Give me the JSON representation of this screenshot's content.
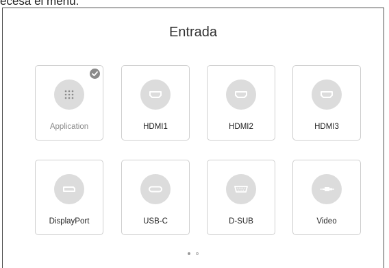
{
  "caption": "ecesa el menú.",
  "panel": {
    "title": "Entrada"
  },
  "inputs": [
    {
      "label": "Application",
      "icon": "apps-grid-icon",
      "selected": true
    },
    {
      "label": "HDMI1",
      "icon": "hdmi-port-icon",
      "selected": false
    },
    {
      "label": "HDMI2",
      "icon": "hdmi-port-icon",
      "selected": false
    },
    {
      "label": "HDMI3",
      "icon": "hdmi-port-icon",
      "selected": false
    },
    {
      "label": "DisplayPort",
      "icon": "displayport-icon",
      "selected": false
    },
    {
      "label": "USB-C",
      "icon": "usb-c-port-icon",
      "selected": false
    },
    {
      "label": "D-SUB",
      "icon": "vga-port-icon",
      "selected": false
    },
    {
      "label": "Video",
      "icon": "composite-video-icon",
      "selected": false
    }
  ],
  "pager": {
    "page_count": 2,
    "current_page": 1
  },
  "colors": {
    "icon_bg": "#dcdcdc",
    "icon_fg": "#ffffff",
    "badge": "#8a8a8a",
    "tile_border": "#cfcfcf"
  }
}
